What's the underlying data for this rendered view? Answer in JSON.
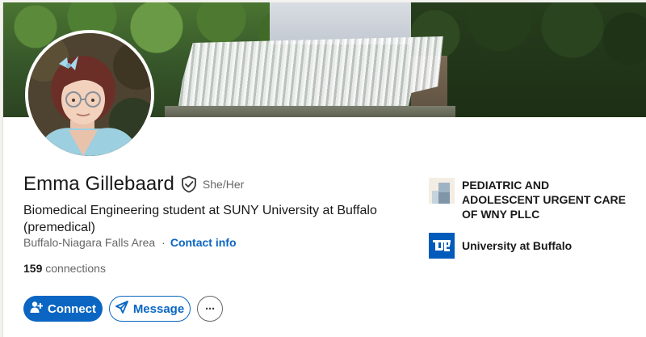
{
  "profile": {
    "name": "Emma Gillebaard",
    "pronouns": "She/Her",
    "headline": "Biomedical Engineering student at SUNY University at Buffalo (premedical)",
    "location": "Buffalo-Niagara Falls Area",
    "separator": "·",
    "contact_link": "Contact info",
    "connections_count": "159",
    "connections_label": " connections"
  },
  "actions": {
    "connect_label": "Connect",
    "message_label": "Message",
    "more_label": "···"
  },
  "experience": [
    {
      "name": "PEDIATRIC AND ADOLESCENT URGENT CARE OF WNY PLLC",
      "logo": "building-placeholder-icon"
    },
    {
      "name": "University at Buffalo",
      "logo": "ub-logo-icon"
    }
  ],
  "colors": {
    "brand_blue": "#0a66c2",
    "ub_blue": "#005bbb",
    "text_primary": "#191919",
    "text_secondary": "#666666"
  },
  "icons": {
    "verified": "verified-shield-icon",
    "connect": "add-person-icon",
    "message": "send-icon",
    "more": "more-horizontal-icon"
  }
}
